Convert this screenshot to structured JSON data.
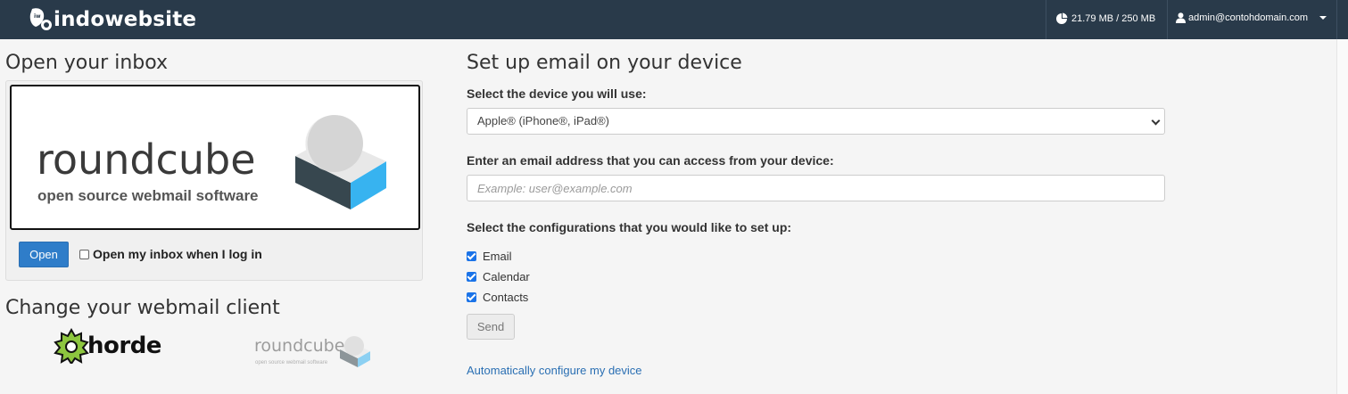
{
  "header": {
    "brand": "indowebsite",
    "disk_usage": "21.79 MB / 250 MB",
    "user": "admin@contohdomain.com"
  },
  "inbox": {
    "title": "Open your inbox",
    "client_logo_text": "roundcube",
    "client_logo_tagline": "open source webmail software",
    "open_label": "Open",
    "auto_open_label": "Open my inbox when I log in",
    "auto_open_checked": false
  },
  "webmail": {
    "title": "Change your webmail client",
    "clients": [
      "horde",
      "roundcube"
    ],
    "roundcube_tagline": "open source webmail software"
  },
  "setup": {
    "title": "Set up email on your device",
    "device_label": "Select the device you will use:",
    "device_value": "Apple® (iPhone®, iPad®)",
    "email_label": "Enter an email address that you can access from your device:",
    "email_placeholder": "Example: user@example.com",
    "config_label": "Select the configurations that you would like to set up:",
    "configs": [
      {
        "label": "Email",
        "checked": true
      },
      {
        "label": "Calendar",
        "checked": true
      },
      {
        "label": "Contacts",
        "checked": true
      }
    ],
    "send_label": "Send",
    "auto_config_link": "Automatically configure my device"
  },
  "colors": {
    "topbar": "#293a4a",
    "primary": "#2f7dc9",
    "link": "#2a6fb3",
    "checkbox": "#1a73e8"
  }
}
